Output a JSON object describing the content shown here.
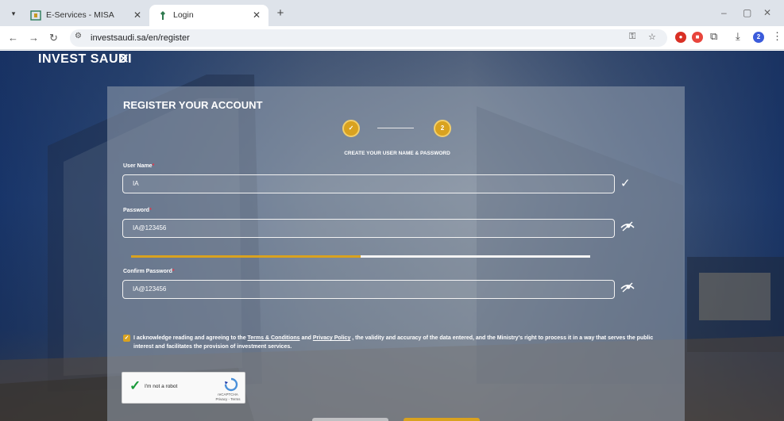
{
  "browser": {
    "tabs": [
      {
        "title": "E-Services - MISA",
        "favicon": "misa-icon",
        "active": false
      },
      {
        "title": "Login",
        "favicon": "misa-icon",
        "active": true
      }
    ],
    "url": "investsaudi.sa/en/register",
    "new_tab_symbol": "+",
    "window_controls": [
      "–",
      "▢",
      "✕"
    ],
    "extension_badge": "2",
    "colors": {
      "tabstrip": "#dee3ea",
      "omnibox": "#eef1f5"
    }
  },
  "page": {
    "brand": "INVEST SAUDI",
    "form": {
      "title": "REGISTER YOUR ACCOUNT",
      "steps": [
        {
          "label": "✓",
          "state": "done"
        },
        {
          "label": "2",
          "state": "current"
        }
      ],
      "step_caption": "CREATE YOUR USER NAME & PASSWORD",
      "fields": {
        "username": {
          "label": "User Name",
          "required_mark": "*",
          "value": "IA"
        },
        "password": {
          "label": "Password",
          "required_mark": "*",
          "value": "IA@123456"
        },
        "confirm": {
          "label": "Confirm Password",
          "required_mark": "*",
          "value": "IA@123456"
        }
      },
      "password_strength": 0.5,
      "consent": {
        "checked": true,
        "text_before": "I acknowledge reading and agreeing to the ",
        "terms_link": "Terms & Conditions",
        "text_and": " and ",
        "privacy_link": "Privacy Policy",
        "text_after": " , the validity and accuracy of the data entered, and the Ministry's right to process it in a way that serves the public interest and facilitates the provision of investment services."
      },
      "captcha": {
        "label": "I'm not a robot",
        "brand": "reCAPTCHA",
        "links": "Privacy - Terms",
        "checked": true
      }
    },
    "colors": {
      "accent": "#d9a21f",
      "panel": "rgba(150,160,175,0.55)"
    }
  }
}
